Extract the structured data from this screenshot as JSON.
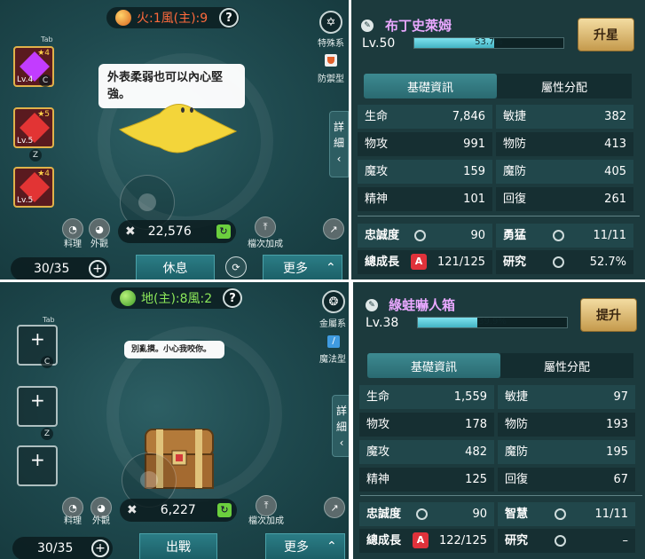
{
  "top": {
    "element": {
      "label": "火:1風(主):9",
      "color": "#ff6a3c"
    },
    "help": "?",
    "type": {
      "label": "特殊系",
      "icon": "star-hex-icon"
    },
    "subtype": {
      "label": "防禦型",
      "icon": "shield-icon"
    },
    "tab_label": "Tab",
    "slots": [
      {
        "filled": true,
        "level": "Lv.4",
        "stars": "★4",
        "key": "C",
        "gem_color": "#c23cff"
      },
      {
        "filled": true,
        "level": "Lv.5",
        "stars": "★5",
        "key": "Z",
        "gem_color": "#e23434"
      },
      {
        "filled": true,
        "level": "Lv.5",
        "stars": "★4",
        "key": "",
        "gem_color": "#e23434"
      }
    ],
    "bubble": "外表柔弱也可以內心堅強。",
    "cook": "料理",
    "appearance": "外觀",
    "power": "22,576",
    "reset_label": "檔次加成",
    "capacity": "30/35",
    "action": "休息",
    "more": "更多",
    "detail_tab": "詳細",
    "name": "布丁史萊姆",
    "level": "Lv.50",
    "xp_text": "53.7%",
    "xp": 0.537,
    "upgrade": "升星",
    "tab_basic": "基礎資訊",
    "tab_attr": "屬性分配",
    "stats": [
      [
        "生命",
        "7,846",
        "敏捷",
        "382"
      ],
      [
        "物攻",
        "991",
        "物防",
        "413"
      ],
      [
        "魔攻",
        "159",
        "魔防",
        "405"
      ],
      [
        "精神",
        "101",
        "回復",
        "261"
      ]
    ],
    "traits": [
      [
        "忠誠度",
        "90",
        "勇猛",
        "11/11"
      ],
      [
        "總成長",
        "121/125",
        "研究",
        "52.7%"
      ]
    ],
    "grade": "A"
  },
  "bottom": {
    "element": {
      "label": "地(主):8風:2",
      "color": "#8ce85a"
    },
    "help": "?",
    "type": {
      "label": "金屬系",
      "icon": "gear-crest-icon"
    },
    "subtype": {
      "label": "魔法型",
      "icon": "wand-icon"
    },
    "tab_label": "Tab",
    "slots": [
      {
        "filled": false,
        "level": "",
        "stars": "",
        "key": "C"
      },
      {
        "filled": false,
        "level": "",
        "stars": "",
        "key": "Z"
      },
      {
        "filled": false,
        "level": "",
        "stars": "",
        "key": ""
      }
    ],
    "bubble": "別亂摸。小心我咬你。",
    "cook": "料理",
    "appearance": "外觀",
    "power": "6,227",
    "reset_label": "檔次加成",
    "capacity": "30/35",
    "action": "出戰",
    "more": "更多",
    "detail_tab": "詳細",
    "name": "綠蛙嚇人箱",
    "level": "Lv.38",
    "xp_text": "39.9%",
    "xp": 0.399,
    "upgrade": "提升",
    "tab_basic": "基礎資訊",
    "tab_attr": "屬性分配",
    "stats": [
      [
        "生命",
        "1,559",
        "敏捷",
        "97"
      ],
      [
        "物攻",
        "178",
        "物防",
        "193"
      ],
      [
        "魔攻",
        "482",
        "魔防",
        "195"
      ],
      [
        "精神",
        "125",
        "回復",
        "67"
      ]
    ],
    "traits": [
      [
        "忠誠度",
        "90",
        "智慧",
        "11/11"
      ],
      [
        "總成長",
        "122/125",
        "研究",
        "–"
      ]
    ],
    "grade": "A"
  }
}
